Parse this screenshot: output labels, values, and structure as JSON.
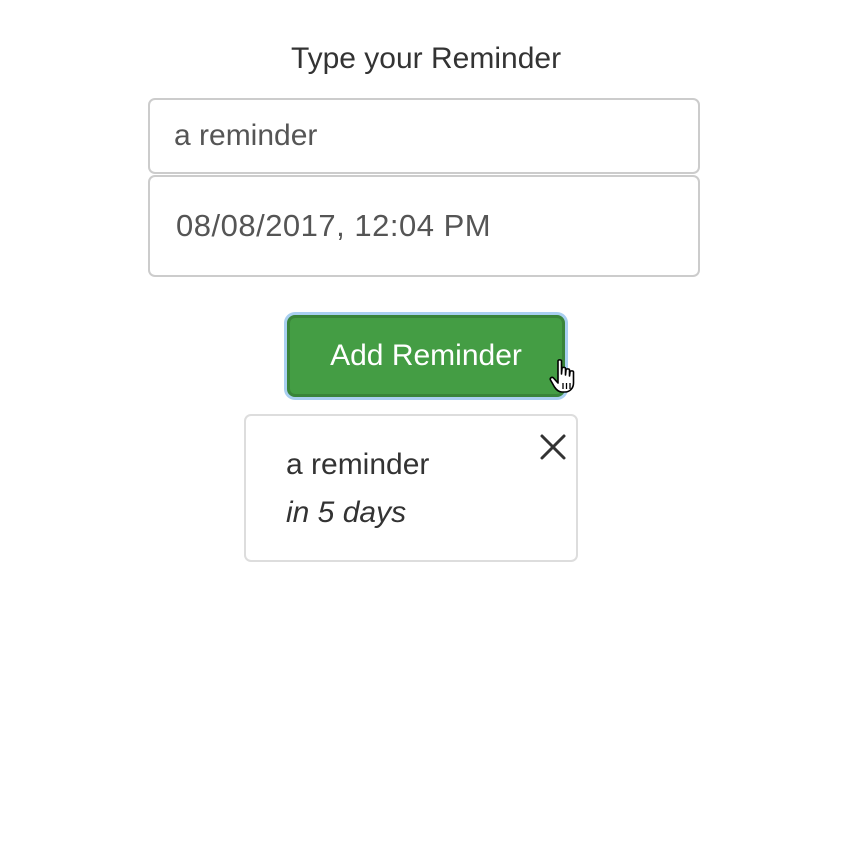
{
  "form": {
    "heading": "Type your Reminder",
    "reminder_text_value": "a reminder",
    "due_date_value": "08/08/2017, 12:04 PM",
    "add_button_label": "Add Reminder"
  },
  "reminders": [
    {
      "text": "a reminder",
      "relative_time": "in 5 days",
      "delete_icon": "close-icon"
    }
  ],
  "colors": {
    "button_green": "#449d44",
    "button_focus_ring": "#a9cff0",
    "border_gray": "#cccccc",
    "text": "#333333"
  },
  "cursor_icon": "hand-pointer-icon"
}
